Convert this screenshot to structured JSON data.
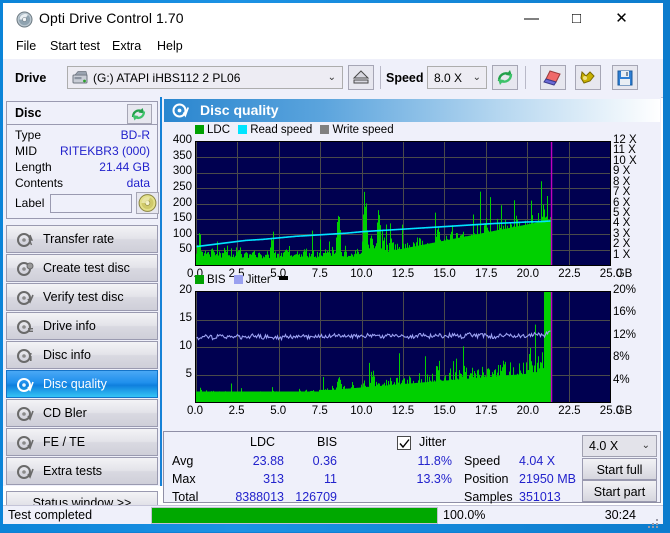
{
  "window": {
    "title": "Opti Drive Control 1.70",
    "app_icon": "disc-icon",
    "minimize": "—",
    "maximize": "□",
    "close": "✕"
  },
  "menu": [
    {
      "label": "File"
    },
    {
      "label": "Start test"
    },
    {
      "label": "Extra"
    },
    {
      "label": "Help"
    }
  ],
  "toolbar": {
    "drive_label": "Drive",
    "drive_value": "(G:)  ATAPI iHBS112  2 PL06",
    "drive_caret": "⌄",
    "eject_icon": "eject-icon",
    "speed_label": "Speed",
    "speed_value": "8.0 X",
    "speed_caret": "⌄",
    "refresh_icon": "refresh-icon",
    "erase_icon": "eraser-icon",
    "tools_icon": "tools-icon",
    "save_icon": "save-icon"
  },
  "disc_panel": {
    "header": "Disc",
    "refresh_icon": "refresh-icon",
    "rows": [
      {
        "key": "Type",
        "value": "BD-R"
      },
      {
        "key": "MID",
        "value": "RITEKBR3 (000)"
      },
      {
        "key": "Length",
        "value": "21.44 GB"
      },
      {
        "key": "Contents",
        "value": "data"
      }
    ],
    "label_key": "Label",
    "label_value": "",
    "label_placeholder": "",
    "cd_icon": "cd-icon"
  },
  "sidebar": {
    "items": [
      {
        "label": "Transfer rate",
        "icon": "disc-test-icon",
        "active": false
      },
      {
        "label": "Create test disc",
        "icon": "disc-burn-icon",
        "active": false
      },
      {
        "label": "Verify test disc",
        "icon": "disc-verify-icon",
        "active": false
      },
      {
        "label": "Drive info",
        "icon": "disc-info-icon",
        "active": false
      },
      {
        "label": "Disc info",
        "icon": "disc-detail-icon",
        "active": false
      },
      {
        "label": "Disc quality",
        "icon": "disc-quality-icon",
        "active": true
      },
      {
        "label": "CD Bler",
        "icon": "disc-bler-icon",
        "active": false
      },
      {
        "label": "FE / TE",
        "icon": "disc-fete-icon",
        "active": false
      },
      {
        "label": "Extra tests",
        "icon": "disc-extra-icon",
        "active": false
      }
    ],
    "status_window_button": "Status window >>"
  },
  "main": {
    "title": "Disc quality",
    "title_icon": "disc-quality-icon"
  },
  "colors": {
    "plot_background": "#000050",
    "ldc_green": "#00d000",
    "bis_green": "#00d000",
    "read_speed_cyan": "#00e5ff",
    "write_speed_gray": "#808080",
    "jitter_lavender": "#9aa0f0",
    "marker_magenta": "#c000c0",
    "accent_blue": "#1581d6",
    "value_blue": "#2222cc",
    "progress_green": "#00a800"
  },
  "chart_data": [
    {
      "type": "area",
      "id": "ldc-chart",
      "title": "Disc quality",
      "legend": [
        {
          "label": "LDC",
          "color": "#00a000"
        },
        {
          "label": "Read speed",
          "color": "#00e5ff"
        },
        {
          "label": "Write speed",
          "color": "#808080"
        }
      ],
      "legend_position": "top-left",
      "grid": true,
      "xlabel": "GB",
      "xlim": [
        0.0,
        25.0
      ],
      "xticks": [
        "0.0",
        "2.5",
        "5.0",
        "7.5",
        "10.0",
        "12.5",
        "15.0",
        "17.5",
        "20.0",
        "22.5",
        "25.0"
      ],
      "ylabel_left": "LDC",
      "ylim_left": [
        0,
        400
      ],
      "yticks_left": [
        "400",
        "350",
        "300",
        "250",
        "200",
        "150",
        "100",
        "50"
      ],
      "ylabel_right": "Speed",
      "ylim_right": [
        0,
        12
      ],
      "yticks_right": [
        "12 X",
        "11 X",
        "10 X",
        "9 X",
        "8 X",
        "7 X",
        "6 X",
        "5 X",
        "4 X",
        "3 X",
        "2 X",
        "1 X"
      ],
      "data_end_gb": 21.44,
      "marker_gb": 21.44,
      "series": [
        {
          "name": "LDC",
          "color": "#00d000",
          "x": [
            0.0,
            0.2,
            0.4,
            0.6,
            0.8,
            1.0,
            1.2,
            1.4,
            1.6,
            1.8,
            2.0,
            2.2,
            2.4,
            2.6,
            2.8,
            3.0,
            3.2,
            3.4,
            3.6,
            3.8,
            4.0,
            4.2,
            4.4,
            4.6,
            4.8,
            5.0,
            5.2,
            5.4,
            5.6,
            5.8,
            6.0,
            6.2,
            6.4,
            6.6,
            6.8,
            7.0,
            7.2,
            7.4,
            7.6,
            7.8,
            8.0,
            8.2,
            8.4,
            8.6,
            8.8,
            9.0,
            9.2,
            9.4,
            9.6,
            9.8,
            10.0,
            10.2,
            10.4,
            10.6,
            10.8,
            11.0,
            11.2,
            11.4,
            11.6,
            11.8,
            12.0,
            12.2,
            12.4,
            12.6,
            12.8,
            13.0,
            13.2,
            13.4,
            13.6,
            13.8,
            14.0,
            14.2,
            14.4,
            14.6,
            14.8,
            15.0,
            15.2,
            15.4,
            15.6,
            15.8,
            16.0,
            16.2,
            16.4,
            16.6,
            16.8,
            17.0,
            17.2,
            17.4,
            17.6,
            17.8,
            18.0,
            18.2,
            18.4,
            18.6,
            18.8,
            19.0,
            19.2,
            19.4,
            19.6,
            19.8,
            20.0,
            20.2,
            20.4,
            20.6,
            20.8,
            21.0,
            21.2,
            21.4
          ],
          "values": [
            40,
            118,
            42,
            50,
            38,
            62,
            35,
            48,
            40,
            70,
            38,
            42,
            36,
            60,
            34,
            44,
            38,
            52,
            35,
            40,
            33,
            45,
            36,
            110,
            34,
            42,
            38,
            55,
            36,
            44,
            35,
            48,
            40,
            52,
            38,
            60,
            35,
            45,
            38,
            50,
            36,
            55,
            40,
            200,
            42,
            60,
            38,
            48,
            45,
            58,
            40,
            315,
            48,
            120,
            55,
            230,
            62,
            90,
            58,
            95,
            60,
            75,
            65,
            85,
            70,
            80,
            68,
            95,
            72,
            88,
            75,
            90,
            78,
            130,
            82,
            95,
            85,
            160,
            90,
            105,
            95,
            118,
            98,
            110,
            100,
            125,
            105,
            130,
            110,
            120,
            112,
            140,
            115,
            155,
            120,
            145,
            125,
            160,
            130,
            150,
            135,
            205,
            140,
            175,
            150,
            188,
            160,
            190
          ]
        },
        {
          "name": "Read speed",
          "color": "#00e5ff",
          "x": [
            0.0,
            1.0,
            2.0,
            3.0,
            4.0,
            5.0,
            6.0,
            7.0,
            8.0,
            9.0,
            10.0,
            11.0,
            12.0,
            13.0,
            14.0,
            15.0,
            16.0,
            17.0,
            18.0,
            19.0,
            20.0,
            21.0,
            21.4
          ],
          "values": [
            1.8,
            2.0,
            2.2,
            2.4,
            2.5,
            2.65,
            2.8,
            2.9,
            3.0,
            3.1,
            3.25,
            3.35,
            3.45,
            3.55,
            3.65,
            3.75,
            3.85,
            3.95,
            4.05,
            4.12,
            4.2,
            4.25,
            4.3
          ]
        }
      ]
    },
    {
      "type": "area",
      "id": "bis-jitter-chart",
      "legend": [
        {
          "label": "BIS",
          "color": "#00a000"
        },
        {
          "label": "Jitter",
          "color": "#9aa0f0"
        }
      ],
      "legend_position": "top-left",
      "grid": true,
      "xlabel": "GB",
      "xlim": [
        0.0,
        25.0
      ],
      "xticks": [
        "0.0",
        "2.5",
        "5.0",
        "7.5",
        "10.0",
        "12.5",
        "15.0",
        "17.5",
        "20.0",
        "22.5",
        "25.0"
      ],
      "ylabel_left": "BIS",
      "ylim_left": [
        0,
        20
      ],
      "yticks_left": [
        "20",
        "15",
        "10",
        "5"
      ],
      "ylabel_right": "Jitter",
      "ylim_right": [
        0,
        20
      ],
      "yticks_right": [
        "20%",
        "16%",
        "12%",
        "8%",
        "4%"
      ],
      "data_end_gb": 21.44,
      "marker_gb": 21.44,
      "series": [
        {
          "name": "BIS",
          "color": "#00d000",
          "x": [
            0.0,
            0.2,
            0.4,
            0.6,
            0.8,
            1.0,
            1.2,
            1.4,
            1.6,
            1.8,
            2.0,
            2.2,
            2.4,
            2.6,
            2.8,
            3.0,
            3.2,
            3.4,
            3.6,
            3.8,
            4.0,
            4.2,
            4.4,
            4.6,
            4.8,
            5.0,
            5.2,
            5.4,
            5.6,
            5.8,
            6.0,
            6.2,
            6.4,
            6.6,
            6.8,
            7.0,
            7.2,
            7.4,
            7.6,
            7.8,
            8.0,
            8.2,
            8.4,
            8.6,
            8.8,
            9.0,
            9.2,
            9.4,
            9.6,
            9.8,
            10.0,
            10.2,
            10.4,
            10.6,
            10.8,
            11.0,
            11.2,
            11.4,
            11.6,
            11.8,
            12.0,
            12.2,
            12.4,
            12.6,
            12.8,
            13.0,
            13.2,
            13.4,
            13.6,
            13.8,
            14.0,
            14.2,
            14.4,
            14.6,
            14.8,
            15.0,
            15.2,
            15.4,
            15.6,
            15.8,
            16.0,
            16.2,
            16.4,
            16.6,
            16.8,
            17.0,
            17.2,
            17.4,
            17.6,
            17.8,
            18.0,
            18.2,
            18.4,
            18.6,
            18.8,
            19.0,
            19.2,
            19.4,
            19.6,
            19.8,
            20.0,
            20.2,
            20.4,
            20.6,
            20.8,
            21.0,
            21.2,
            21.4
          ],
          "values": [
            1.2,
            2.8,
            1.4,
            2.2,
            1.3,
            2.5,
            1.5,
            2.0,
            1.4,
            2.6,
            1.3,
            1.8,
            1.4,
            2.3,
            1.2,
            1.9,
            1.5,
            2.4,
            1.3,
            2.0,
            1.4,
            2.2,
            1.3,
            2.6,
            1.4,
            2.1,
            1.5,
            2.4,
            1.3,
            2.0,
            1.4,
            2.3,
            1.6,
            2.5,
            1.5,
            2.8,
            1.4,
            2.2,
            1.8,
            2.6,
            2.0,
            3.0,
            2.2,
            5.9,
            2.5,
            3.2,
            2.4,
            3.5,
            2.8,
            3.8,
            3.0,
            4.2,
            3.2,
            6.7,
            3.5,
            4.5,
            3.4,
            4.8,
            3.6,
            4.4,
            3.8,
            4.6,
            4.0,
            4.8,
            4.2,
            4.5,
            4.1,
            5.0,
            4.3,
            4.8,
            4.5,
            5.2,
            4.4,
            9.0,
            4.8,
            5.5,
            5.0,
            7.3,
            5.2,
            6.2,
            5.5,
            6.8,
            5.4,
            6.0,
            5.6,
            7.6,
            5.8,
            6.4,
            5.7,
            6.5,
            6.0,
            7.0,
            5.9,
            8.0,
            6.2,
            6.8,
            6.0,
            7.2,
            6.3,
            6.9,
            6.5,
            10.1,
            6.4,
            8.2,
            6.8,
            11.0
          ]
        },
        {
          "name": "Jitter",
          "color": "#9aa0f0",
          "x": [
            0.0,
            0.5,
            1.0,
            1.5,
            2.0,
            2.5,
            3.0,
            3.5,
            4.0,
            4.5,
            5.0,
            5.5,
            6.0,
            6.5,
            7.0,
            7.5,
            8.0,
            8.5,
            9.0,
            9.5,
            10.0,
            10.5,
            11.0,
            11.5,
            12.0,
            12.5,
            13.0,
            13.5,
            14.0,
            14.5,
            15.0,
            15.5,
            16.0,
            16.5,
            17.0,
            17.5,
            18.0,
            18.5,
            19.0,
            19.5,
            20.0,
            20.5,
            21.0,
            21.4
          ],
          "values": [
            11.6,
            11.9,
            11.7,
            12.0,
            11.8,
            11.9,
            11.7,
            12.1,
            11.8,
            11.9,
            11.6,
            12.0,
            11.8,
            11.9,
            11.7,
            12.0,
            11.9,
            12.1,
            11.8,
            12.0,
            11.9,
            12.2,
            11.8,
            12.1,
            11.9,
            12.0,
            11.8,
            12.2,
            11.9,
            12.1,
            12.0,
            12.2,
            11.9,
            12.3,
            12.0,
            12.1,
            11.9,
            12.2,
            12.0,
            12.1,
            11.9,
            12.3,
            12.1,
            13.3
          ]
        }
      ]
    }
  ],
  "stats": {
    "col_headers": {
      "ldc": "LDC",
      "bis": "BIS",
      "jitter": "Jitter"
    },
    "jitter_checkbox_checked": true,
    "rows": [
      {
        "label": "Avg",
        "ldc": "23.88",
        "bis": "0.36",
        "jitter": "11.8%"
      },
      {
        "label": "Max",
        "ldc": "313",
        "bis": "11",
        "jitter": "13.3%"
      },
      {
        "label": "Total",
        "ldc": "8388013",
        "bis": "126709",
        "jitter": ""
      }
    ],
    "info": [
      {
        "label": "Speed",
        "value": "4.04 X"
      },
      {
        "label": "Position",
        "value": "21950 MB"
      },
      {
        "label": "Samples",
        "value": "351013"
      }
    ],
    "speed_select_value": "4.0 X",
    "speed_select_caret": "⌄",
    "start_full_button": "Start full",
    "start_part_button": "Start part"
  },
  "statusbar": {
    "text": "Test completed",
    "progress_percent": "100.0%",
    "progress_value": 100,
    "elapsed": "30:24"
  }
}
